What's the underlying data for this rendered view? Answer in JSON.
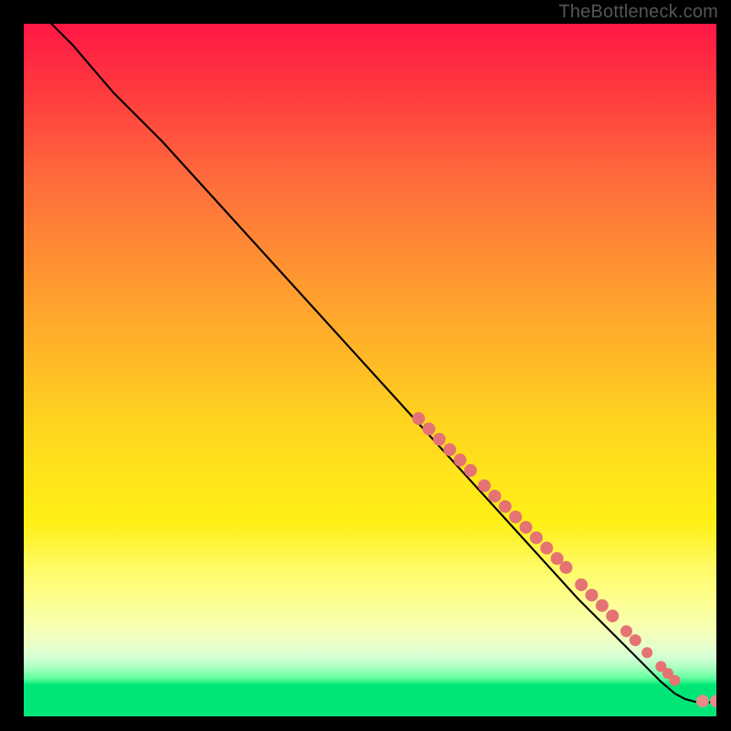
{
  "watermark": "TheBottleneck.com",
  "chart_data": {
    "type": "line",
    "title": "",
    "xlabel": "",
    "ylabel": "",
    "xlim": [
      0,
      100
    ],
    "ylim": [
      0,
      100
    ],
    "grid": false,
    "legend": false,
    "series": [
      {
        "name": "bottleneck-curve",
        "x": [
          4,
          7,
          10,
          13,
          20,
          30,
          40,
          50,
          60,
          70,
          80,
          85,
          90,
          92,
          94,
          95.5,
          97,
          98.5,
          100
        ],
        "y": [
          100,
          97,
          93.5,
          90,
          83,
          72,
          61,
          50,
          39,
          28,
          17,
          12,
          7,
          5,
          3.3,
          2.5,
          2.1,
          2.05,
          2
        ]
      }
    ],
    "markers": [
      {
        "name": "highlight-segment-1",
        "shape": "circle",
        "radius": 7,
        "points": [
          {
            "x": 57,
            "y": 43
          },
          {
            "x": 58.5,
            "y": 41.5
          },
          {
            "x": 60,
            "y": 40
          },
          {
            "x": 61.5,
            "y": 38.5
          },
          {
            "x": 63,
            "y": 37
          },
          {
            "x": 64.5,
            "y": 35.5
          }
        ]
      },
      {
        "name": "highlight-segment-2",
        "shape": "circle",
        "radius": 7,
        "points": [
          {
            "x": 66.5,
            "y": 33.3
          },
          {
            "x": 68,
            "y": 31.8
          },
          {
            "x": 69.5,
            "y": 30.3
          },
          {
            "x": 71,
            "y": 28.8
          },
          {
            "x": 72.5,
            "y": 27.3
          },
          {
            "x": 74,
            "y": 25.8
          },
          {
            "x": 75.5,
            "y": 24.3
          },
          {
            "x": 77,
            "y": 22.8
          },
          {
            "x": 78.3,
            "y": 21.5
          }
        ]
      },
      {
        "name": "highlight-segment-3",
        "shape": "circle",
        "radius": 7,
        "points": [
          {
            "x": 80.5,
            "y": 19.0
          },
          {
            "x": 82,
            "y": 17.5
          },
          {
            "x": 83.5,
            "y": 16.0
          },
          {
            "x": 85,
            "y": 14.5
          }
        ]
      },
      {
        "name": "highlight-segment-4",
        "shape": "circle",
        "radius": 6.5,
        "points": [
          {
            "x": 87,
            "y": 12.3
          },
          {
            "x": 88.3,
            "y": 11.0
          }
        ]
      },
      {
        "name": "highlight-dot-5",
        "shape": "circle",
        "radius": 6,
        "points": [
          {
            "x": 90,
            "y": 9.2
          }
        ]
      },
      {
        "name": "highlight-segment-6",
        "shape": "circle",
        "radius": 6,
        "points": [
          {
            "x": 92,
            "y": 7.2
          },
          {
            "x": 93,
            "y": 6.2
          },
          {
            "x": 94,
            "y": 5.2
          }
        ]
      },
      {
        "name": "end-pair",
        "shape": "circle",
        "radius": 7,
        "points": [
          {
            "x": 98.0,
            "y": 2.2
          },
          {
            "x": 100.0,
            "y": 2.2
          }
        ]
      }
    ]
  }
}
